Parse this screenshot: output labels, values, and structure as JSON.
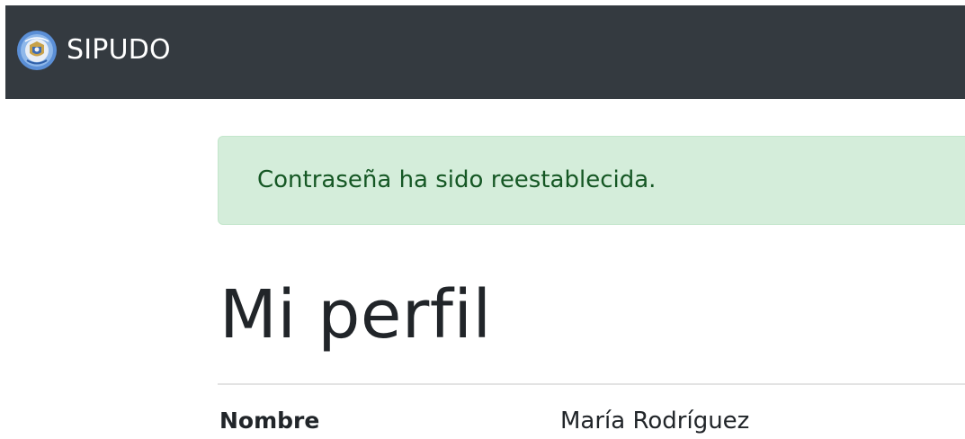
{
  "navbar": {
    "brand": {
      "logo_icon": "university-seal-icon",
      "title": "SIPUDO"
    }
  },
  "alert": {
    "type": "success",
    "message": "Contraseña ha sido reestablecida."
  },
  "profile": {
    "title": "Mi perfil",
    "fields": [
      {
        "label": "Nombre",
        "value": "María Rodríguez"
      }
    ]
  },
  "colors": {
    "navbar_bg": "#343a40",
    "alert_bg": "#d4edda",
    "alert_text": "#155724",
    "text": "#212529"
  }
}
